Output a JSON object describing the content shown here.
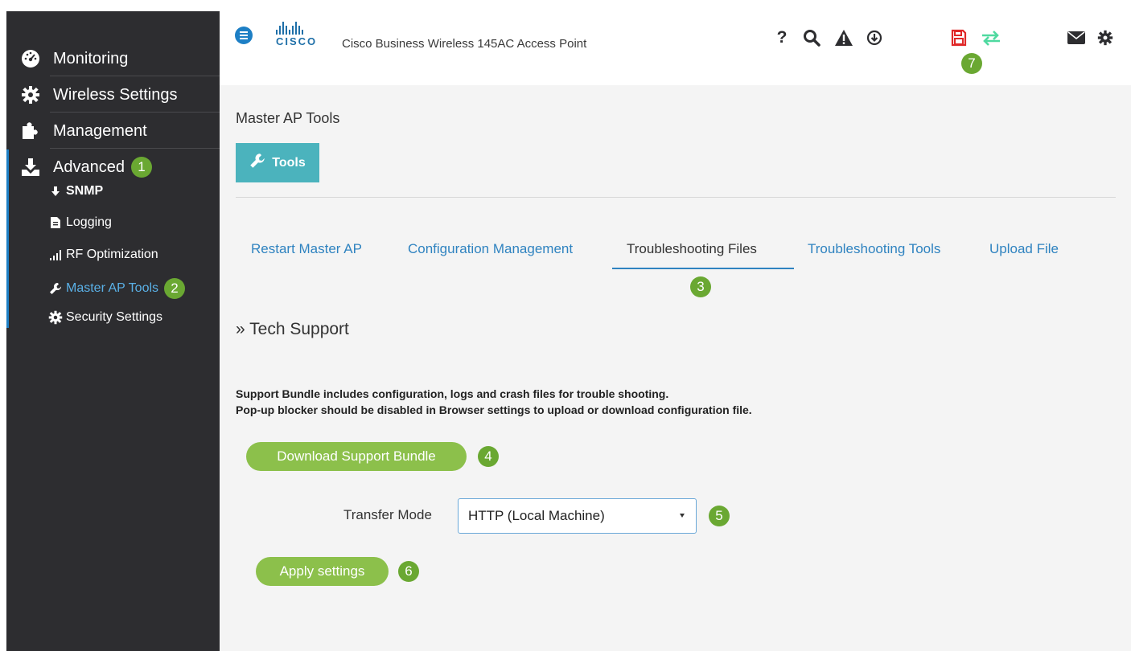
{
  "sidebar": {
    "items": [
      {
        "label": "Monitoring",
        "icon": "dashboard-icon"
      },
      {
        "label": "Wireless Settings",
        "icon": "gear-icon"
      },
      {
        "label": "Management",
        "icon": "puzzle-icon"
      },
      {
        "label": "Advanced",
        "icon": "download-tray-icon",
        "badge": "1"
      }
    ],
    "sub_items": [
      {
        "label": "SNMP",
        "icon": "arrow-down-icon"
      },
      {
        "label": "Logging",
        "icon": "document-icon"
      },
      {
        "label": "RF Optimization",
        "icon": "signal-bars-icon"
      },
      {
        "label": "Master AP Tools",
        "icon": "wrench-icon",
        "badge": "2",
        "active": true
      },
      {
        "label": "Security Settings",
        "icon": "gear-icon"
      }
    ]
  },
  "header": {
    "logo_text": "CISCO",
    "title": "Cisco Business Wireless 145AC Access Point",
    "icons": [
      "help-icon",
      "search-icon",
      "warning-icon",
      "download-circle-icon",
      "save-icon",
      "sync-arrows-icon",
      "mail-icon",
      "settings-icon"
    ],
    "save_badge": "7"
  },
  "main": {
    "page_title": "Master AP Tools",
    "tools_button": "Tools",
    "tabs": [
      {
        "label": "Restart Master AP"
      },
      {
        "label": "Configuration Management"
      },
      {
        "label": "Troubleshooting Files",
        "active": true,
        "badge": "3"
      },
      {
        "label": "Troubleshooting Tools"
      },
      {
        "label": "Upload File"
      }
    ],
    "section_title": "» Tech Support",
    "description_line1": "Support Bundle includes configuration, logs and crash files for trouble shooting.",
    "description_line2": "Pop-up blocker should be disabled in Browser settings to upload or download configuration file.",
    "download_button": "Download Support Bundle",
    "download_badge": "4",
    "transfer_mode_label": "Transfer Mode",
    "transfer_mode_value": "HTTP (Local Machine)",
    "transfer_mode_badge": "5",
    "apply_button": "Apply settings",
    "apply_badge": "6"
  },
  "colors": {
    "sidebar_bg": "#2d2d30",
    "accent_blue": "#2f83c0",
    "tools_teal": "#4bb3bd",
    "button_green": "#8cc04b",
    "badge_green": "#6aa832",
    "save_red": "#e02828",
    "sync_green": "#4fd9a0"
  }
}
